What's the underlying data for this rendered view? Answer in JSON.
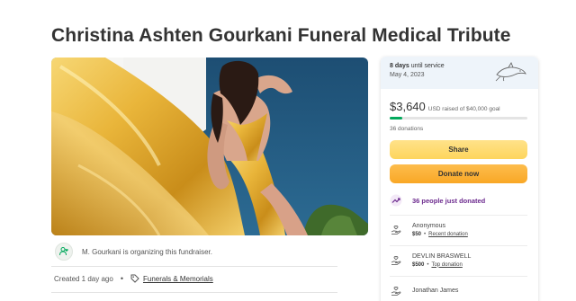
{
  "page": {
    "title": "Christina Ashten Gourkani Funeral Medical Tribute"
  },
  "organizer": {
    "text": "M. Gourkani is organizing this fundraiser."
  },
  "meta": {
    "created": "Created 1 day ago",
    "dot": "•",
    "category": "Funerals & Memorials"
  },
  "sidebar": {
    "days_bold": "8 days",
    "days_rest": " until service",
    "date": "May 4, 2023",
    "amount": "$3,640",
    "goal": "USD raised of $40,000 goal",
    "progress_fraction": 0.091,
    "donations": "36 donations",
    "share_label": "Share",
    "donate_label": "Donate now",
    "recent_text": "36 people just donated",
    "donors": [
      {
        "name": "Anonymous",
        "amount": "$50",
        "dot": "•",
        "link": "Recent donation"
      },
      {
        "name": "DEVLIN BRASWELL",
        "amount": "$500",
        "dot": "•",
        "link": "Top donation"
      },
      {
        "name": "Jonathan James",
        "amount": "",
        "dot": "",
        "link": ""
      }
    ]
  },
  "colors": {
    "progress": "#02a95c",
    "share": "#fdd55c",
    "donate": "#f9a826",
    "recent": "#6c2a8e"
  },
  "icons": {
    "organizer": "person-with-heart-icon",
    "category": "tag-icon",
    "recent": "trending-up-icon",
    "donor": "hand-with-heart-icon",
    "logo": "dolphin-logo"
  }
}
